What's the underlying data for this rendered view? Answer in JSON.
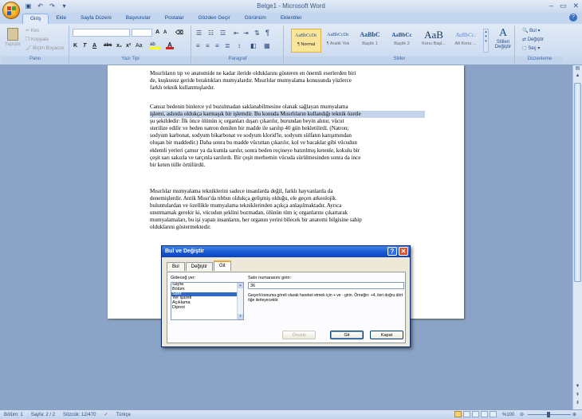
{
  "window": {
    "title": "Belge1 - Microsoft Word",
    "controls": [
      "–",
      "▭",
      "✕"
    ]
  },
  "quick_access": [
    "save-icon",
    "undo-icon",
    "redo-icon"
  ],
  "ribbon_tabs": [
    "Giriş",
    "Ekle",
    "Sayfa Düzeni",
    "Başvurular",
    "Postalar",
    "Gözden Geçir",
    "Görünüm",
    "Eklentiler"
  ],
  "ribbon": {
    "clipboard": {
      "label": "Pano",
      "paste": "Yapıştır",
      "cut": "Kes",
      "copy": "Kopyala",
      "format_painter": "Biçim Boyacısı"
    },
    "font": {
      "label": "Yazı Tipi",
      "font_name": "",
      "font_size": "",
      "grow": "A",
      "shrink": "A",
      "buttons": [
        "K",
        "T",
        "A",
        "abc",
        "x₂",
        "x²",
        "Aa"
      ]
    },
    "paragraph": {
      "label": "Paragraf"
    },
    "styles": {
      "label": "Stiller",
      "items": [
        {
          "sample": "AaBbCcDc",
          "name": "¶ Normal",
          "selected": true
        },
        {
          "sample": "AaBbCcDc",
          "name": "¶ Aralık Yok",
          "selected": false
        },
        {
          "sample": "AaBbC",
          "name": "Başlık 1",
          "selected": false
        },
        {
          "sample": "AaBbCc",
          "name": "Başlık 2",
          "selected": false
        },
        {
          "sample": "AaB",
          "name": "Konu Başl...",
          "selected": false
        },
        {
          "sample": "AaBbCc.",
          "name": "Alt Konu ...",
          "selected": false
        }
      ],
      "change_styles": "Stilleri Değiştir"
    },
    "editing": {
      "label": "Düzenleme",
      "find": "Bul",
      "replace": "Değiştir",
      "select": "Seç"
    }
  },
  "document": {
    "paragraphs": [
      {
        "lines": [
          "Mısırlıların  tıp ve anatomide ne kadar ileride olduklarını gösteren en önemli eserlerden biri",
          "de, kuşkusuz geride bıraktıkları mumyalardır.  Mısırlılar  mumyalama  konusunda yüzlerce",
          "farklı teknik kullanmışlardır."
        ]
      },
      {
        "lines": [
          "Cansız bedenin binlerce  yıl bozulmadan saklanabilmesine  olanak sağlayan mumyalama",
          "işlemi, aslında oldukça karmaşık bir işlemdir.  Bu konuda Mısırlıların  kullandığı teknik özetle",
          "şu şekildedir: İlk önce ölünün iç organları dışarı çıkarılır,  burundan beyin alınır,  vücut",
          "sterilize edilir ve beden natron denilen bir madde ile sarılıp 40 gün bekletilirdi.  (Natron;",
          "sodyum karbonat, sodyum bikarbonat ve sodyum klorid'le, sodyum sülfatın karışımından",
          "oluşan bir maddedir.) Daha sonra bu madde vücuttan çıkarılır, kol ve bacaklar gibi vücudun",
          "eklemli yerleri çamur ya da kumla sarılır,  sonra beden reçineye batırılmış  ketenle, kokulu bir",
          "çeşit sarı sakızla  ve tarçınla sarılırdı.  Bir çeşit merhemin vücuda sürülmesinden sonra da ince",
          "bir keten tülle örtülürdü."
        ]
      },
      {
        "lines": [
          "Mısırlılar mumyalama  tekniklerini sadece insanlarda değil, farklı hayvanlarda da",
          "denemişlerdir.  Antik Mısır'da tıbbın oldukça gelişmiş  olduğu, ele geçen arkeolojik",
          "buluntulardan ve özellikle mumyalama  tekniklerinden açıkça anlaşılmaktadır.  Ayrıca",
          "unutmamak gerekir ki, vücudun şeklini  bozmadan, ölünün tüm iç organlarını çıkartarak",
          "mumyalamaları, bu işi yapan insanların, her organın yerini bilecek bir anatomi bilgisine sahip",
          "olduklarını göstermektedir."
        ]
      }
    ]
  },
  "dialog": {
    "title": "Bul ve Değiştir",
    "tabs": [
      "Bul",
      "Değiştir",
      "Git"
    ],
    "active_tab": "Git",
    "go_to_what_label": "Gideceğ yer:",
    "list_items": [
      "Sayfa",
      "Bölüm",
      "Satır",
      "Yer işareti",
      "Açıklama",
      "Dipnot"
    ],
    "selected_item": "Satır",
    "input_label": "Satır numarasını girin:",
    "input_value": "36",
    "hint": "Geçerli konuma göreli olarak hareket etmek için + ve - girin. Örneğin: +4, ileri doğru dört öğe ilerleyecektir.",
    "buttons": {
      "previous": "Önceki",
      "go_to": "Git",
      "close": "Kapat"
    }
  },
  "status_bar": {
    "section": "Bölüm: 1",
    "page": "Sayfa: 2 / 2",
    "words": "Sözcük: 12/470",
    "language": "Türkçe",
    "zoom": "%100"
  }
}
